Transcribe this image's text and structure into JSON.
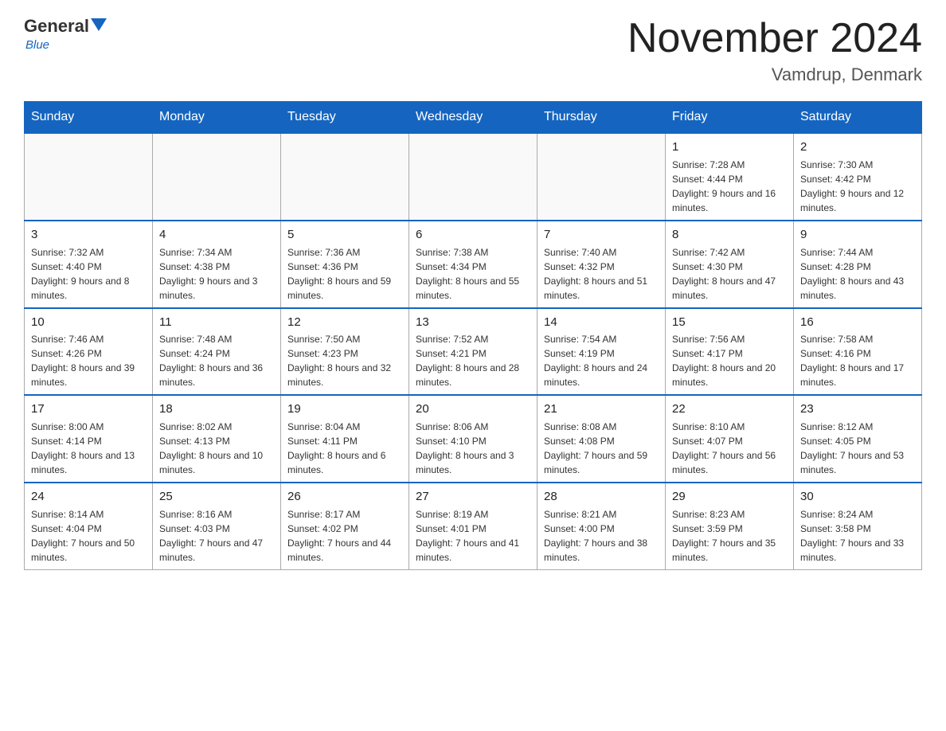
{
  "header": {
    "logo_general": "General",
    "logo_blue": "Blue",
    "month_title": "November 2024",
    "location": "Vamdrup, Denmark"
  },
  "days_of_week": [
    "Sunday",
    "Monday",
    "Tuesday",
    "Wednesday",
    "Thursday",
    "Friday",
    "Saturday"
  ],
  "weeks": [
    {
      "days": [
        {
          "number": "",
          "info": ""
        },
        {
          "number": "",
          "info": ""
        },
        {
          "number": "",
          "info": ""
        },
        {
          "number": "",
          "info": ""
        },
        {
          "number": "",
          "info": ""
        },
        {
          "number": "1",
          "info": "Sunrise: 7:28 AM\nSunset: 4:44 PM\nDaylight: 9 hours and 16 minutes."
        },
        {
          "number": "2",
          "info": "Sunrise: 7:30 AM\nSunset: 4:42 PM\nDaylight: 9 hours and 12 minutes."
        }
      ]
    },
    {
      "days": [
        {
          "number": "3",
          "info": "Sunrise: 7:32 AM\nSunset: 4:40 PM\nDaylight: 9 hours and 8 minutes."
        },
        {
          "number": "4",
          "info": "Sunrise: 7:34 AM\nSunset: 4:38 PM\nDaylight: 9 hours and 3 minutes."
        },
        {
          "number": "5",
          "info": "Sunrise: 7:36 AM\nSunset: 4:36 PM\nDaylight: 8 hours and 59 minutes."
        },
        {
          "number": "6",
          "info": "Sunrise: 7:38 AM\nSunset: 4:34 PM\nDaylight: 8 hours and 55 minutes."
        },
        {
          "number": "7",
          "info": "Sunrise: 7:40 AM\nSunset: 4:32 PM\nDaylight: 8 hours and 51 minutes."
        },
        {
          "number": "8",
          "info": "Sunrise: 7:42 AM\nSunset: 4:30 PM\nDaylight: 8 hours and 47 minutes."
        },
        {
          "number": "9",
          "info": "Sunrise: 7:44 AM\nSunset: 4:28 PM\nDaylight: 8 hours and 43 minutes."
        }
      ]
    },
    {
      "days": [
        {
          "number": "10",
          "info": "Sunrise: 7:46 AM\nSunset: 4:26 PM\nDaylight: 8 hours and 39 minutes."
        },
        {
          "number": "11",
          "info": "Sunrise: 7:48 AM\nSunset: 4:24 PM\nDaylight: 8 hours and 36 minutes."
        },
        {
          "number": "12",
          "info": "Sunrise: 7:50 AM\nSunset: 4:23 PM\nDaylight: 8 hours and 32 minutes."
        },
        {
          "number": "13",
          "info": "Sunrise: 7:52 AM\nSunset: 4:21 PM\nDaylight: 8 hours and 28 minutes."
        },
        {
          "number": "14",
          "info": "Sunrise: 7:54 AM\nSunset: 4:19 PM\nDaylight: 8 hours and 24 minutes."
        },
        {
          "number": "15",
          "info": "Sunrise: 7:56 AM\nSunset: 4:17 PM\nDaylight: 8 hours and 20 minutes."
        },
        {
          "number": "16",
          "info": "Sunrise: 7:58 AM\nSunset: 4:16 PM\nDaylight: 8 hours and 17 minutes."
        }
      ]
    },
    {
      "days": [
        {
          "number": "17",
          "info": "Sunrise: 8:00 AM\nSunset: 4:14 PM\nDaylight: 8 hours and 13 minutes."
        },
        {
          "number": "18",
          "info": "Sunrise: 8:02 AM\nSunset: 4:13 PM\nDaylight: 8 hours and 10 minutes."
        },
        {
          "number": "19",
          "info": "Sunrise: 8:04 AM\nSunset: 4:11 PM\nDaylight: 8 hours and 6 minutes."
        },
        {
          "number": "20",
          "info": "Sunrise: 8:06 AM\nSunset: 4:10 PM\nDaylight: 8 hours and 3 minutes."
        },
        {
          "number": "21",
          "info": "Sunrise: 8:08 AM\nSunset: 4:08 PM\nDaylight: 7 hours and 59 minutes."
        },
        {
          "number": "22",
          "info": "Sunrise: 8:10 AM\nSunset: 4:07 PM\nDaylight: 7 hours and 56 minutes."
        },
        {
          "number": "23",
          "info": "Sunrise: 8:12 AM\nSunset: 4:05 PM\nDaylight: 7 hours and 53 minutes."
        }
      ]
    },
    {
      "days": [
        {
          "number": "24",
          "info": "Sunrise: 8:14 AM\nSunset: 4:04 PM\nDaylight: 7 hours and 50 minutes."
        },
        {
          "number": "25",
          "info": "Sunrise: 8:16 AM\nSunset: 4:03 PM\nDaylight: 7 hours and 47 minutes."
        },
        {
          "number": "26",
          "info": "Sunrise: 8:17 AM\nSunset: 4:02 PM\nDaylight: 7 hours and 44 minutes."
        },
        {
          "number": "27",
          "info": "Sunrise: 8:19 AM\nSunset: 4:01 PM\nDaylight: 7 hours and 41 minutes."
        },
        {
          "number": "28",
          "info": "Sunrise: 8:21 AM\nSunset: 4:00 PM\nDaylight: 7 hours and 38 minutes."
        },
        {
          "number": "29",
          "info": "Sunrise: 8:23 AM\nSunset: 3:59 PM\nDaylight: 7 hours and 35 minutes."
        },
        {
          "number": "30",
          "info": "Sunrise: 8:24 AM\nSunset: 3:58 PM\nDaylight: 7 hours and 33 minutes."
        }
      ]
    }
  ]
}
